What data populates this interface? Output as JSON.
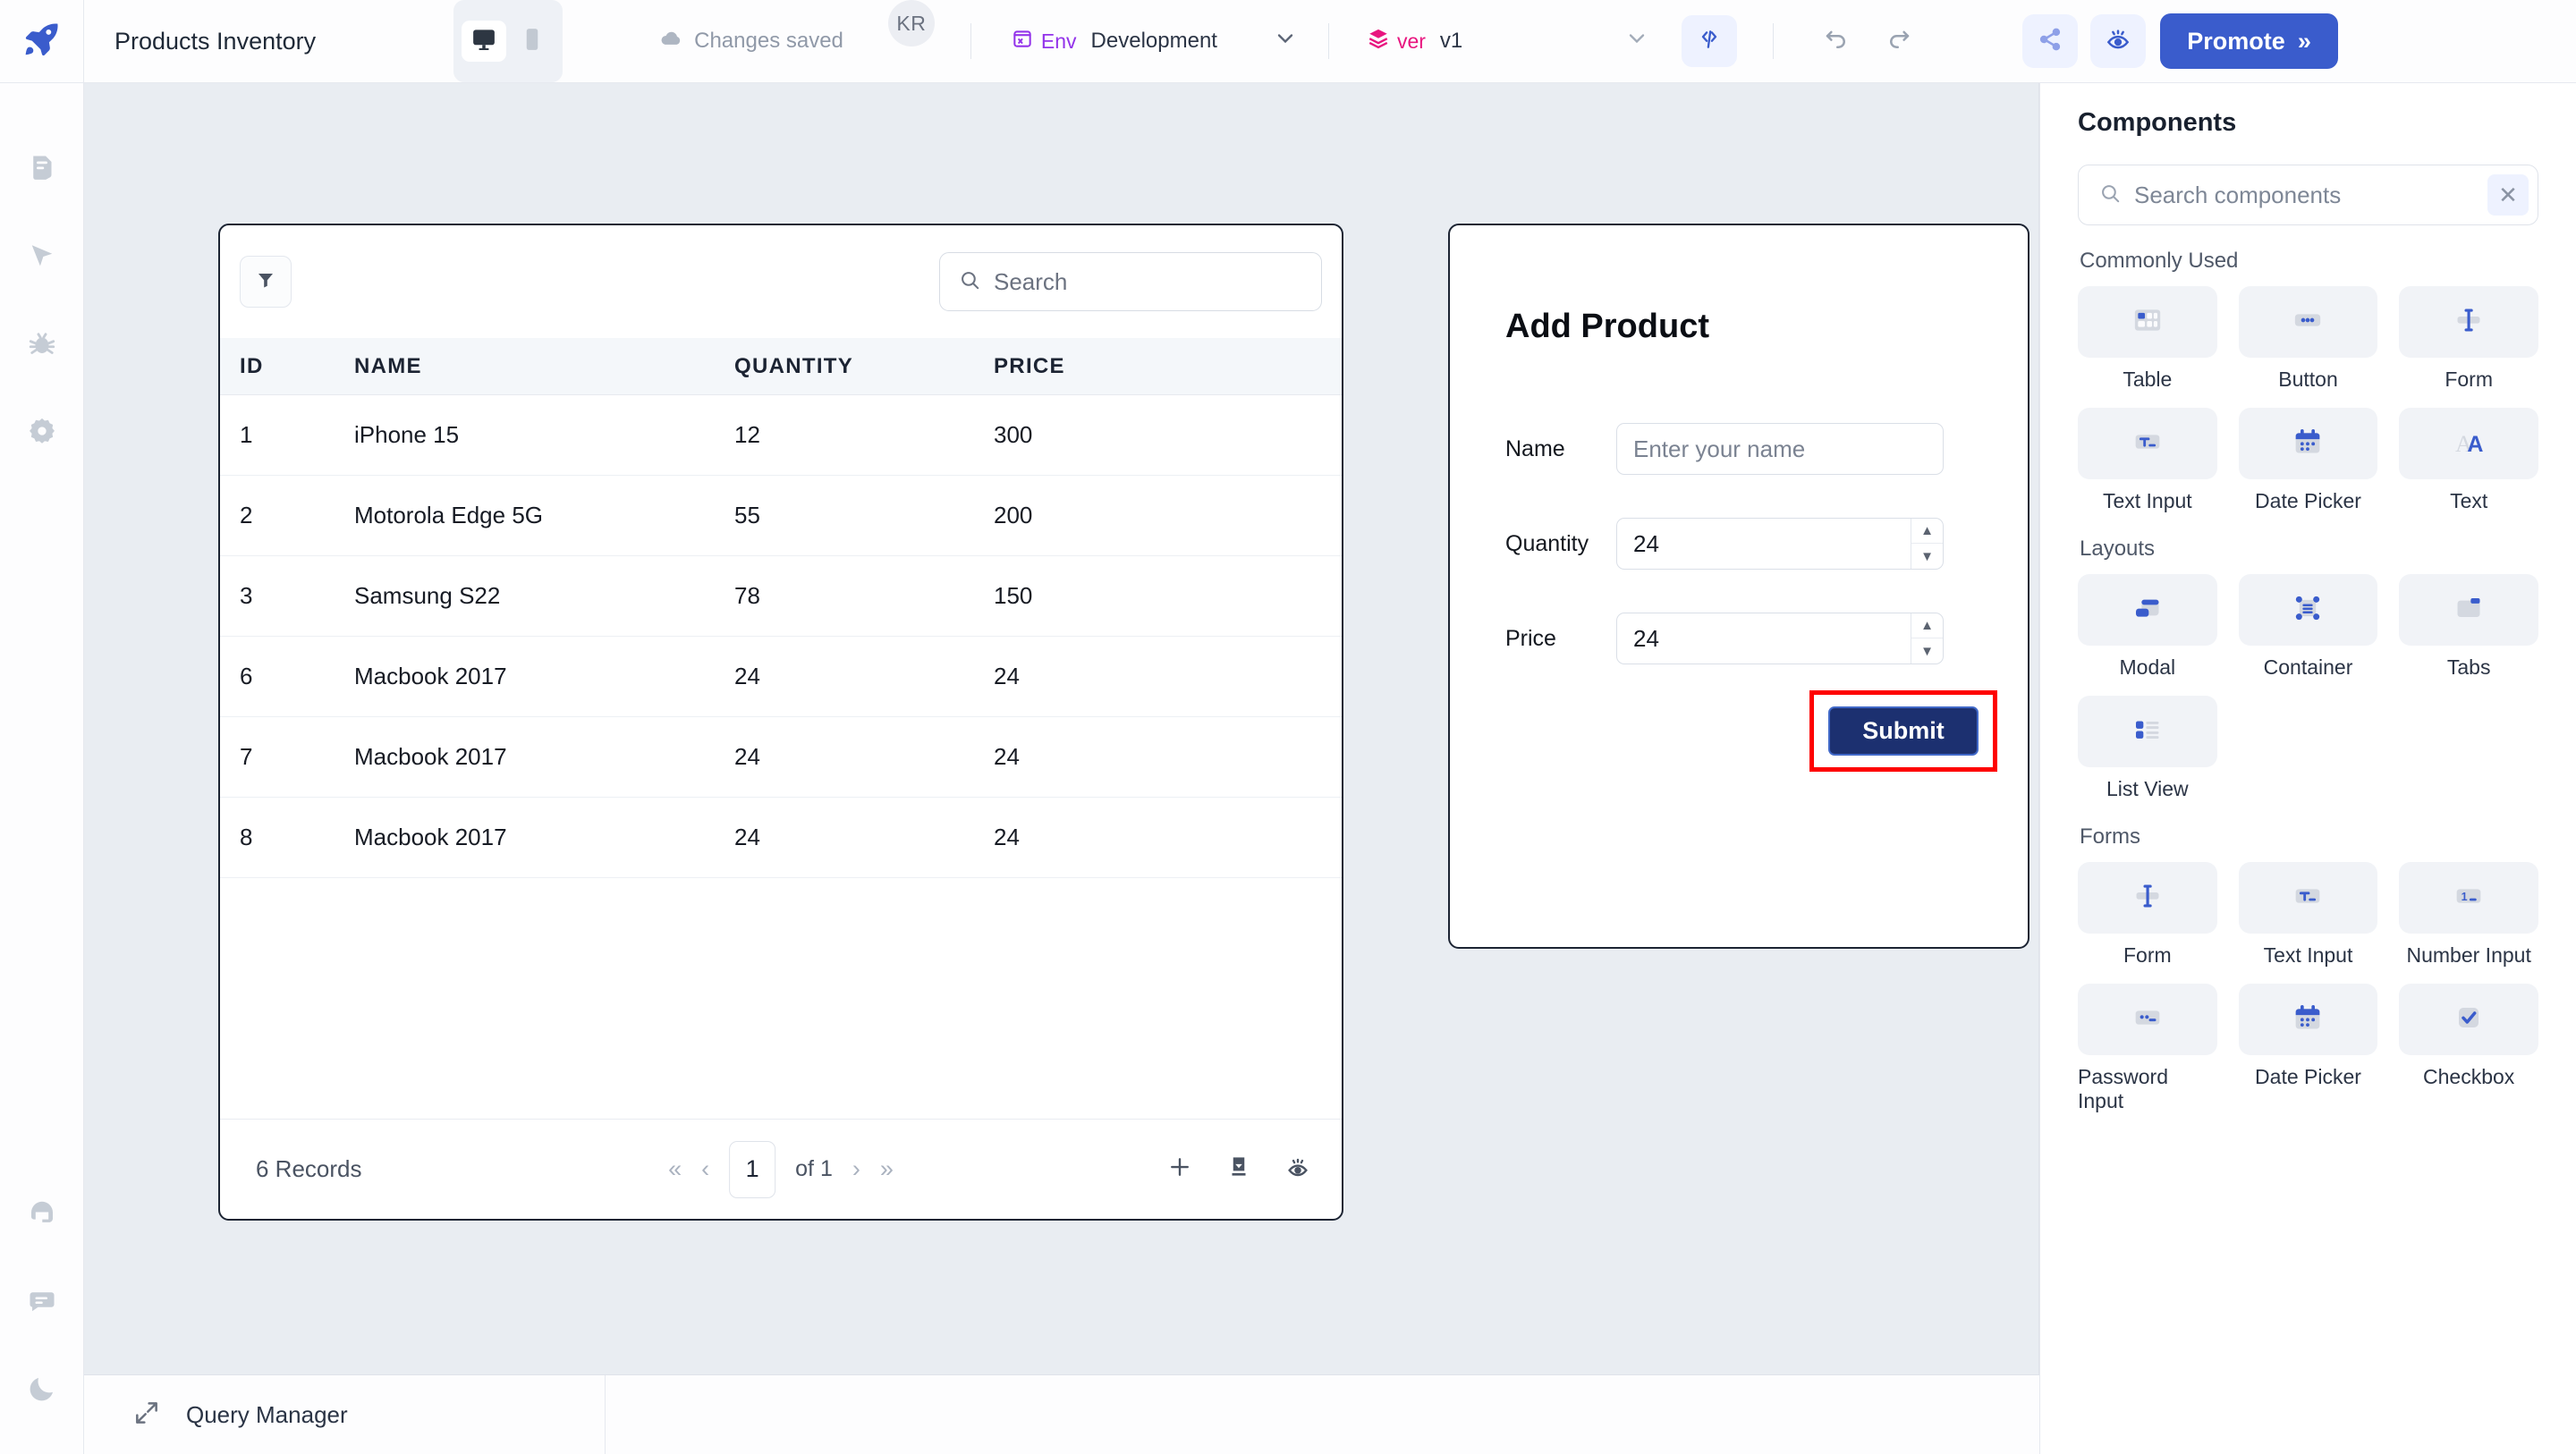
{
  "header": {
    "app_title": "Products Inventory",
    "device_desktop_icon": "desktop-monitor-icon",
    "device_mobile_icon": "mobile-phone-icon",
    "save_status": "Changes saved",
    "save_status_icon": "cloud-check-icon",
    "avatar_initials": "KR",
    "env_chip_label": "Env",
    "env_value": "Development",
    "version_chip_label": "ver",
    "version_value": "v1",
    "refresh_icon": "refresh-code-icon",
    "undo_icon": "undo-arrow-icon",
    "redo_icon": "redo-arrow-icon",
    "share_icon": "share-nodes-icon",
    "preview_icon": "eye-preview-icon",
    "promote_label": "Promote",
    "promote_chevron": "»",
    "logo_icon": "rocket-logo-icon"
  },
  "left_rail": {
    "items": [
      {
        "icon": "pages-document-icon",
        "name": "sidebar-item-pages"
      },
      {
        "icon": "cursor-pointer-icon",
        "name": "sidebar-item-inspector"
      },
      {
        "icon": "bug-debugger-icon",
        "name": "sidebar-item-debugger"
      },
      {
        "icon": "gear-settings-icon",
        "name": "sidebar-item-settings"
      }
    ],
    "bottom_items": [
      {
        "icon": "headset-support-icon",
        "name": "sidebar-item-support"
      },
      {
        "icon": "chat-comment-icon",
        "name": "sidebar-item-comments"
      },
      {
        "icon": "moon-dark-mode-icon",
        "name": "sidebar-item-theme"
      }
    ]
  },
  "table_widget": {
    "filter_icon": "funnel-filter-icon",
    "search_icon": "magnifier-search-icon",
    "search_placeholder": "Search",
    "search_value": "",
    "columns": [
      "ID",
      "NAME",
      "QUANTITY",
      "PRICE"
    ],
    "rows": [
      {
        "id": "1",
        "name": "iPhone 15",
        "quantity": "12",
        "price": "300"
      },
      {
        "id": "2",
        "name": "Motorola Edge 5G",
        "quantity": "55",
        "price": "200"
      },
      {
        "id": "3",
        "name": "Samsung S22",
        "quantity": "78",
        "price": "150"
      },
      {
        "id": "6",
        "name": "Macbook 2017",
        "quantity": "24",
        "price": "24"
      },
      {
        "id": "7",
        "name": "Macbook 2017",
        "quantity": "24",
        "price": "24"
      },
      {
        "id": "8",
        "name": "Macbook 2017",
        "quantity": "24",
        "price": "24"
      }
    ],
    "records_label": "6 Records",
    "page_first": "«",
    "page_prev": "‹",
    "page_current": "1",
    "page_of": "of 1",
    "page_next": "›",
    "page_last": "»",
    "add_row_icon": "plus-add-row-icon",
    "download_icon": "download-export-icon",
    "visibility_icon": "eye-column-visibility-icon"
  },
  "form_widget": {
    "title": "Add Product",
    "fields": [
      {
        "label": "Name",
        "value": "",
        "placeholder": "Enter your name",
        "type": "text"
      },
      {
        "label": "Quantity",
        "value": "24",
        "placeholder": "",
        "type": "number"
      },
      {
        "label": "Price",
        "value": "24",
        "placeholder": "",
        "type": "number"
      }
    ],
    "submit_label": "Submit",
    "highlight_color": "#fe0000"
  },
  "bottom_bar": {
    "expand_icon": "expand-diagonal-icon",
    "query_manager_label": "Query Manager"
  },
  "components_panel": {
    "title": "Components",
    "search_icon": "magnifier-search-icon",
    "search_placeholder": "Search components",
    "search_value": "",
    "clear_icon": "close-x-icon",
    "groups": [
      {
        "title": "Commonly Used",
        "items": [
          {
            "label": "Table",
            "icon": "table-grid-icon"
          },
          {
            "label": "Button",
            "icon": "button-dots-icon"
          },
          {
            "label": "Form",
            "icon": "form-caret-icon"
          },
          {
            "label": "Text Input",
            "icon": "text-input-icon"
          },
          {
            "label": "Date Picker",
            "icon": "calendar-icon"
          },
          {
            "label": "Text",
            "icon": "text-letter-a-icon"
          }
        ]
      },
      {
        "title": "Layouts",
        "items": [
          {
            "label": "Modal",
            "icon": "modal-stack-icon"
          },
          {
            "label": "Container",
            "icon": "container-nodes-icon"
          },
          {
            "label": "Tabs",
            "icon": "tabs-icon"
          },
          {
            "label": "List View",
            "icon": "list-view-icon"
          }
        ]
      },
      {
        "title": "Forms",
        "items": [
          {
            "label": "Form",
            "icon": "form-caret-icon"
          },
          {
            "label": "Text Input",
            "icon": "text-input-icon"
          },
          {
            "label": "Number Input",
            "icon": "number-input-icon"
          },
          {
            "label": "Password Input",
            "icon": "password-input-icon"
          },
          {
            "label": "Date Picker",
            "icon": "calendar-icon"
          },
          {
            "label": "Checkbox",
            "icon": "checkbox-check-icon"
          }
        ]
      }
    ]
  },
  "colors": {
    "brand_blue": "#3a5ccc",
    "canvas_bg": "#e9edf2",
    "env_purple": "#9333ea",
    "version_pink": "#e8157f",
    "submit_navy": "#1c3070",
    "highlight_red": "#fe0000"
  }
}
